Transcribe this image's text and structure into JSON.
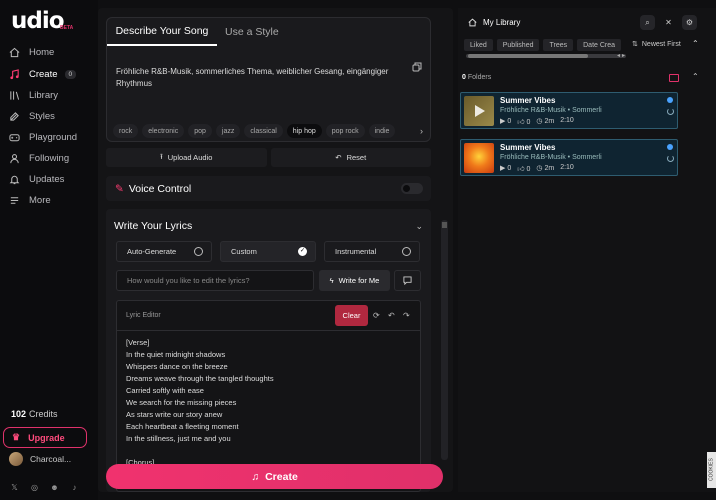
{
  "logo": "udio",
  "beta": "BETA",
  "nav": [
    {
      "label": "Home",
      "icon": "home-icon"
    },
    {
      "label": "Create",
      "icon": "music-note-icon",
      "badge": "0"
    },
    {
      "label": "Library",
      "icon": "library-icon"
    },
    {
      "label": "Styles",
      "icon": "styles-icon"
    },
    {
      "label": "Playground",
      "icon": "playground-icon"
    },
    {
      "label": "Following",
      "icon": "following-icon"
    },
    {
      "label": "Updates",
      "icon": "bell-icon"
    },
    {
      "label": "More",
      "icon": "menu-icon"
    }
  ],
  "credits": {
    "count": "102",
    "label": "Credits"
  },
  "upgrade": "Upgrade",
  "user": "Charcoal...",
  "tabs": [
    "Describe Your Song",
    "Use a Style"
  ],
  "description": "Fröhliche R&B-Musik, sommerliches Thema, weiblicher Gesang, eingängiger Rhythmus",
  "genres": [
    "rock",
    "electronic",
    "pop",
    "jazz",
    "classical",
    "hip hop",
    "pop rock",
    "indie"
  ],
  "actions": {
    "upload": "Upload Audio",
    "reset": "Reset"
  },
  "voice": "Voice Control",
  "lyrics": {
    "title": "Write Your Lyrics",
    "modes": [
      "Auto-Generate",
      "Custom",
      "Instrumental"
    ],
    "edit_placeholder": "How would you like to edit the lyrics?",
    "write_btn": "Write for Me",
    "editor_label": "Lyric Editor",
    "clear": "Clear",
    "lines": [
      "[Verse]",
      "In the quiet midnight shadows",
      "Whispers dance on the breeze",
      "Dreams weave through the tangled thoughts",
      "Carried softly with ease",
      "We search for the missing pieces",
      "As stars write our story anew",
      "Each heartbeat a fleeting moment",
      "In the stillness, just me and you",
      "",
      "[Chorus]"
    ]
  },
  "create": "Create",
  "library": {
    "title": "My Library",
    "filters": [
      "Liked",
      "Published",
      "Trees",
      "Date Crea"
    ],
    "sort": "Newest First",
    "folders_count": "0",
    "folders_label": "Folders",
    "songs": [
      {
        "title": "Summer Vibes",
        "sub": "Fröhliche R&B-Musik  •  Sommerli",
        "plays": "0",
        "likes": "0",
        "age": "2m",
        "duration": "2:10"
      },
      {
        "title": "Summer Vibes",
        "sub": "Fröhliche R&B-Musik  •  Sommerli",
        "plays": "0",
        "likes": "0",
        "age": "2m",
        "duration": "2:10"
      }
    ]
  },
  "cookies": "COOKIES"
}
